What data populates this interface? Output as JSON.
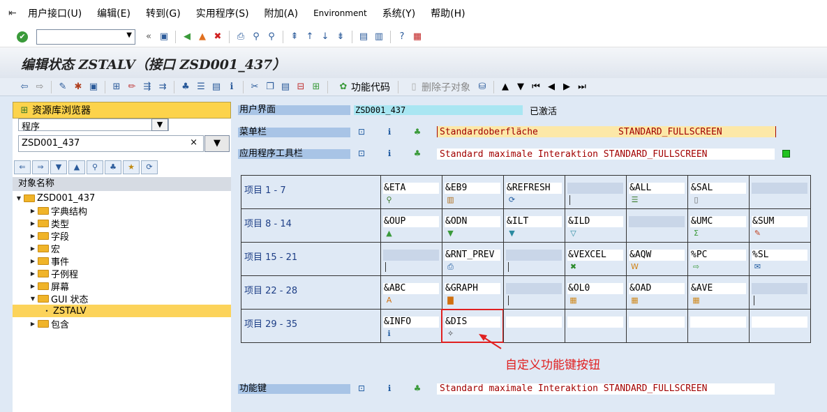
{
  "menubar": {
    "items": [
      "用户接口(U)",
      "编辑(E)",
      "转到(G)",
      "实用程序(S)",
      "附加(A)",
      "Environment",
      "系统(Y)",
      "帮助(H)"
    ]
  },
  "title": "编辑状态 ZSTALV（接口 ZSD001_437）",
  "app_toolbar": {
    "function_code_label": "功能代码",
    "delete_subobject_label": "删除子对象"
  },
  "repository": {
    "header": "资源库浏览器",
    "object_type": "程序",
    "object_name": "ZSD001_437",
    "tree_header": "对象名称",
    "tree": [
      {
        "label": "ZSD001_437",
        "level": 0,
        "arrow": "down"
      },
      {
        "label": "字典结构",
        "level": 1,
        "arrow": "right"
      },
      {
        "label": "类型",
        "level": 1,
        "arrow": "right"
      },
      {
        "label": "字段",
        "level": 1,
        "arrow": "right"
      },
      {
        "label": "宏",
        "level": 1,
        "arrow": "right"
      },
      {
        "label": "事件",
        "level": 1,
        "arrow": "right"
      },
      {
        "label": "子例程",
        "level": 1,
        "arrow": "right"
      },
      {
        "label": "屏幕",
        "level": 1,
        "arrow": "right"
      },
      {
        "label": "GUI 状态",
        "level": 1,
        "arrow": "down"
      },
      {
        "label": "ZSTALV",
        "level": 2,
        "arrow": "dot",
        "selected": true
      },
      {
        "label": "包含",
        "level": 1,
        "arrow": "right"
      }
    ]
  },
  "ui": {
    "user_interface_label": "用户界面",
    "user_interface_value": "ZSD001_437",
    "status": "已激活",
    "menubar_label": "菜单栏",
    "menubar_value": "Standardoberfläche",
    "menubar_name": "STANDARD_FULLSCREEN",
    "apptoolbar_label": "应用程序工具栏",
    "apptoolbar_value": "Standard maximale Interaktion STANDARD_FULLSCREEN",
    "function_keys_label": "功能键",
    "function_keys_value": "Standard maximale Interaktion STANDARD_FULLSCREEN"
  },
  "function_rows": [
    {
      "label": "项目  1 -  7",
      "cells": [
        {
          "code": "&ETA",
          "icon": "find-icon"
        },
        {
          "code": "&EB9",
          "icon": "chart-icon"
        },
        {
          "code": "&REFRESH",
          "icon": "refresh-icon"
        },
        {
          "code": "",
          "icon": "cursor"
        },
        {
          "code": "&ALL",
          "icon": "select-all-icon"
        },
        {
          "code": "&SAL",
          "icon": "deselect-icon"
        },
        {
          "code": "",
          "icon": "none"
        }
      ]
    },
    {
      "label": "项目  8 - 14",
      "cells": [
        {
          "code": "&OUP",
          "icon": "sort-asc-icon"
        },
        {
          "code": "&ODN",
          "icon": "sort-desc-icon"
        },
        {
          "code": "&ILT",
          "icon": "filter-icon"
        },
        {
          "code": "&ILD",
          "icon": "filter-delete-icon"
        },
        {
          "code": "",
          "icon": "none"
        },
        {
          "code": "&UMC",
          "icon": "sum-icon"
        },
        {
          "code": "&SUM",
          "icon": "subtotal-icon"
        }
      ]
    },
    {
      "label": "项目 15 - 21",
      "cells": [
        {
          "code": "",
          "icon": "cursor"
        },
        {
          "code": "&RNT_PREV",
          "icon": "print-preview-icon"
        },
        {
          "code": "",
          "icon": "cursor"
        },
        {
          "code": "&VEXCEL",
          "icon": "excel-icon"
        },
        {
          "code": "&AQW",
          "icon": "word-icon"
        },
        {
          "code": "%PC",
          "icon": "export-icon"
        },
        {
          "code": "%SL",
          "icon": "mail-icon"
        }
      ]
    },
    {
      "label": "项目 22 - 28",
      "cells": [
        {
          "code": "&ABC",
          "icon": "abc-analysis-icon"
        },
        {
          "code": "&GRAPH",
          "icon": "graph-icon"
        },
        {
          "code": "",
          "icon": "cursor"
        },
        {
          "code": "&OL0",
          "icon": "layout-icon"
        },
        {
          "code": "&OAD",
          "icon": "layout-select-icon"
        },
        {
          "code": "&AVE",
          "icon": "layout-save-icon"
        },
        {
          "code": "",
          "icon": "cursor"
        }
      ]
    },
    {
      "label": "项目 29 - 35",
      "cells": [
        {
          "code": "&INFO",
          "icon": "info-icon"
        },
        {
          "code": "&DIS",
          "icon": "custom-key-icon",
          "highlight": true
        },
        {
          "code": "",
          "icon": "none",
          "white": true
        },
        {
          "code": "",
          "icon": "none",
          "white": true
        },
        {
          "code": "",
          "icon": "none",
          "white": true
        },
        {
          "code": "",
          "icon": "none",
          "white": true
        },
        {
          "code": "",
          "icon": "none",
          "white": true
        }
      ]
    }
  ],
  "callout": "自定义功能键按钮",
  "colors": {
    "accent": "#fcd34b",
    "annotation": "#e02020",
    "status_ok": "#21c221"
  }
}
